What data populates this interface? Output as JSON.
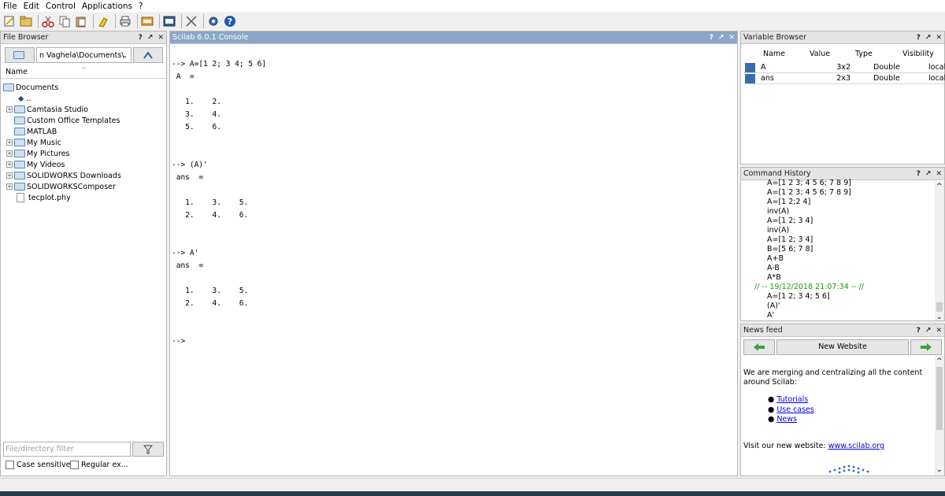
{
  "menu": [
    "File",
    "Edit",
    "Control",
    "Applications",
    "?"
  ],
  "toolbar_icons": [
    "new-file-icon",
    "open-file-icon",
    "cut-icon",
    "copy-icon",
    "paste-icon",
    "clear-console-icon",
    "print-icon",
    "xcos-icon",
    "applications-icon",
    "modules-icon",
    "gear-icon",
    "help-icon"
  ],
  "file_browser": {
    "title": "File Browser",
    "path": "n Vaghela\\Documents\\",
    "column": "Name",
    "root": "Documents",
    "parent": "..",
    "items": [
      "Camtasia Studio",
      "Custom Office Templates",
      "MATLAB",
      "My Music",
      "My Pictures",
      "My Videos",
      "SOLIDWORKS Downloads",
      "SOLIDWORKSComposer",
      "tecplot.phy"
    ],
    "filter_placeholder": "File/directory filter",
    "case_sensitive": "Case sensitive",
    "regular_ex": "Regular ex..."
  },
  "console": {
    "title": "Scilab 6.0.1 Console",
    "lines": [
      "",
      "--> A=[1 2; 3 4; 5 6]",
      " A  =",
      "",
      "   1.    2.",
      "   3.    4.",
      "   5.    6.",
      "",
      "",
      "--> (A)'",
      " ans  =",
      "",
      "   1.    3.    5.",
      "   2.    4.    6.",
      "",
      "",
      "--> A'",
      " ans  =",
      "",
      "   1.    3.    5.",
      "   2.    4.    6.",
      "",
      "",
      "-->"
    ]
  },
  "variable_browser": {
    "title": "Variable Browser",
    "headers": [
      "Name",
      "Value",
      "Type",
      "Visibility"
    ],
    "rows": [
      {
        "name": "A",
        "value": "3x2",
        "type": "Double",
        "visibility": "local"
      },
      {
        "name": "ans",
        "value": "2x3",
        "type": "Double",
        "visibility": "local"
      }
    ]
  },
  "command_history": {
    "title": "Command History",
    "lines": [
      "A=[1 2 3; 4 5 6; 7 8 9]",
      "A=[1 2 3; 4 5 6; 7 8 9]",
      "A=[1 2;2 4]",
      "inv(A)",
      "A=[1 2; 3 4]",
      "inv(A)",
      "A=[1 2; 3 4]",
      "B=[5 6; 7 8]",
      "A+B",
      "A-B",
      "A*B"
    ],
    "session": "// -- 19/12/2018 21:07:34 -- //",
    "session_lines": [
      "A=[1 2; 3 4; 5 6]",
      "(A)'",
      "A'"
    ],
    "session_color": "#1a9a1a"
  },
  "news_feed": {
    "title": "News feed",
    "button": "New Website",
    "text": "We are merging and centralizing all the content around Scilab:",
    "links": [
      "Tutorials",
      "Use cases",
      "News"
    ],
    "visit": "Visit our new website:",
    "url": "www.scilab.org"
  },
  "panel_buttons": [
    "?",
    "↗",
    "✕"
  ]
}
